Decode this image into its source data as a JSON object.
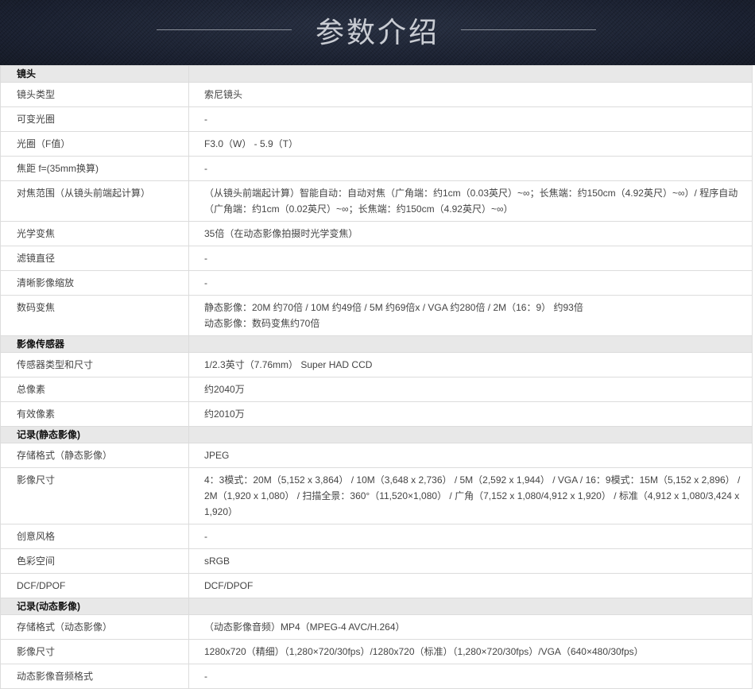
{
  "header": {
    "title": "参数介绍"
  },
  "sections": [
    {
      "title": "镜头",
      "rows": [
        {
          "label": "镜头类型",
          "value": "索尼镜头"
        },
        {
          "label": "可变光圈",
          "value": "-"
        },
        {
          "label": "光圈（F值）",
          "value": "F3.0（W） - 5.9（T）"
        },
        {
          "label": "焦距 f=(35mm换算)",
          "value": "-"
        },
        {
          "label": "对焦范围（从镜头前端起计算）",
          "value": "（从镜头前端起计算）智能自动：自动对焦（广角端：约1cm（0.03英尺）~∞；长焦端：约150cm（4.92英尺）~∞）/ 程序自动（广角端：约1cm（0.02英尺）~∞；长焦端：约150cm（4.92英尺）~∞）"
        },
        {
          "label": "光学变焦",
          "value": "35倍（在动态影像拍摄时光学变焦）"
        },
        {
          "label": "滤镜直径",
          "value": "-"
        },
        {
          "label": "清晰影像缩放",
          "value": "-"
        },
        {
          "label": "数码变焦",
          "value": "静态影像：20M 约70倍 / 10M 约49倍 / 5M 约69倍x / VGA 约280倍 / 2M（16：9） 约93倍",
          "value2": "动态影像：数码变焦约70倍"
        }
      ]
    },
    {
      "title": "影像传感器",
      "rows": [
        {
          "label": "传感器类型和尺寸",
          "value": "1/2.3英寸（7.76mm） Super HAD CCD"
        },
        {
          "label": "总像素",
          "value": "约2040万"
        },
        {
          "label": "有效像素",
          "value": "约2010万"
        }
      ]
    },
    {
      "title": "记录(静态影像)",
      "rows": [
        {
          "label": "存储格式（静态影像）",
          "value": "JPEG"
        },
        {
          "label": "影像尺寸",
          "value": "4：3模式：20M（5,152 x 3,864） / 10M（3,648 x 2,736） / 5M（2,592 x 1,944） / VGA / 16：9模式：15M（5,152 x 2,896） / 2M（1,920 x 1,080） / 扫描全景：360°（11,520×1,080） / 广角（7,152 x 1,080/4,912 x 1,920） / 标准（4,912 x 1,080/3,424 x 1,920）"
        },
        {
          "label": "创意风格",
          "value": "-"
        },
        {
          "label": "色彩空间",
          "value": "sRGB"
        },
        {
          "label": "DCF/DPOF",
          "value": "DCF/DPOF"
        }
      ]
    },
    {
      "title": "记录(动态影像)",
      "rows": [
        {
          "label": "存储格式（动态影像）",
          "value": "（动态影像音频）MP4（MPEG-4 AVC/H.264）"
        },
        {
          "label": "影像尺寸",
          "value": "1280x720（精细）（1,280×720/30fps）/1280x720（标准）（1,280×720/30fps）/VGA（640×480/30fps）"
        },
        {
          "label": "动态影像音频格式",
          "value": "-"
        }
      ]
    }
  ]
}
